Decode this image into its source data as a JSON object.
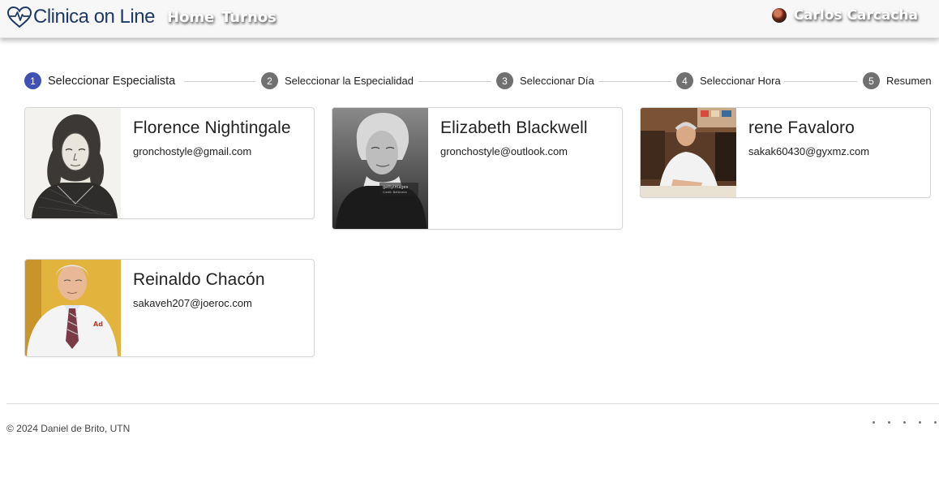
{
  "navbar": {
    "brand": "Clinica on Line",
    "brand_icon": "heartbeat-icon",
    "links": [
      "Home",
      "Turnos"
    ],
    "user_name": "Carlos Carcacha",
    "brand_color": "#1f3a64"
  },
  "stepper": {
    "steps": [
      {
        "number": "1",
        "label": "Seleccionar Especialista",
        "active": true
      },
      {
        "number": "2",
        "label": "Seleccionar la Especialidad",
        "active": false
      },
      {
        "number": "3",
        "label": "Seleccionar Día",
        "active": false
      },
      {
        "number": "4",
        "label": "Seleccionar Hora",
        "active": false
      },
      {
        "number": "5",
        "label": "Resumen",
        "active": false
      }
    ],
    "active_color": "#3f51b5",
    "inactive_color": "#707070"
  },
  "specialists": [
    {
      "name": "Florence Nightingale",
      "email": "gronchostyle@gmail.com",
      "photo": "engraving portrait"
    },
    {
      "name": "Elizabeth Blackwell",
      "email": "gronchostyle@outlook.com",
      "photo": "black and white photo"
    },
    {
      "name": "rene Favaloro",
      "email": "sakak60430@gyxmz.com",
      "photo": "color photo at desk"
    },
    {
      "name": "Reinaldo Chacón",
      "email": "sakaveh207@joeroc.com",
      "photo": "color photo in white coat"
    }
  ],
  "footer": {
    "copyright": "© 2024 Daniel de Brito, UTN"
  }
}
